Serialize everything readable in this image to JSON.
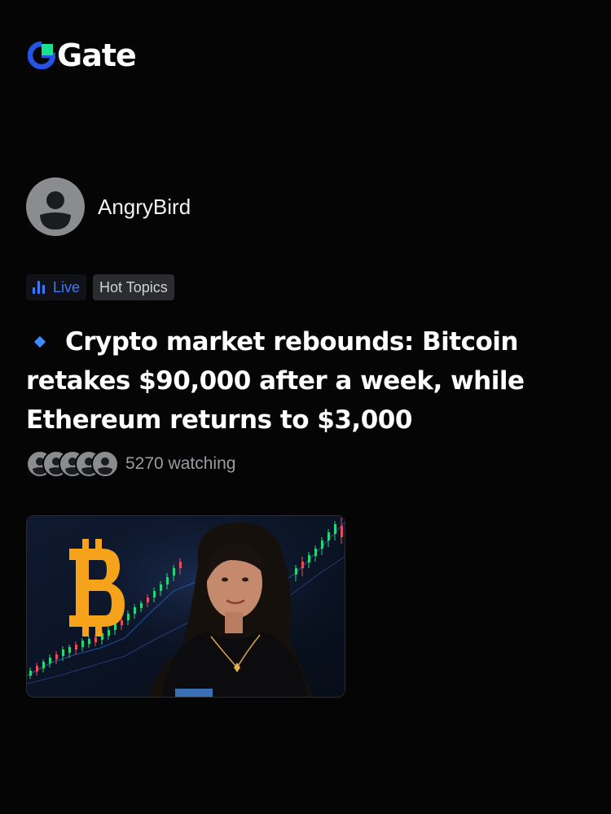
{
  "brand": {
    "name": "Gate",
    "accent": "#17e08f",
    "primary": "#2354e6"
  },
  "post": {
    "author": "AngryBird",
    "tags": {
      "live": "Live",
      "topic": "Hot Topics"
    },
    "headline": "Crypto market rebounds: Bitcoin retakes $90,000 after a week, while Ethereum returns to $3,000",
    "watching_text": "5270 watching"
  },
  "colors": {
    "live_blue": "#3b7bff",
    "bitcoin_orange": "#f7a21b",
    "background": "#050505"
  },
  "icons": {
    "avatar": "user-avatar-icon",
    "live": "bar-chart-icon",
    "bullet": "diamond-icon",
    "coin": "bitcoin-icon"
  }
}
